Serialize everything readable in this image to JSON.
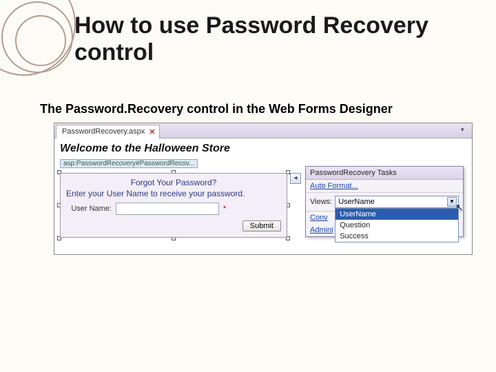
{
  "slide": {
    "title": "How to use Password Recovery control",
    "subtitle": "The Password.Recovery control in the Web Forms Designer"
  },
  "tab": {
    "filename": "PasswordRecovery.aspx",
    "close": "✕"
  },
  "page": {
    "heading": "Welcome to the Halloween Store",
    "asp_tag": "asp:PasswordRecovery#PasswordRecov..."
  },
  "control": {
    "forgot": "Forgot Your Password?",
    "instruction": "Enter your User Name to receive your password.",
    "username_label": "User Name:",
    "asterisk": "*",
    "submit": "Submit"
  },
  "smart_panel": {
    "title": "PasswordRecovery Tasks",
    "auto_format": "Auto Format...",
    "views_label": "Views:",
    "views_value": "UserName",
    "options": [
      "UserName",
      "Question",
      "Success"
    ],
    "convert": "Conv",
    "admin": "Admini"
  }
}
